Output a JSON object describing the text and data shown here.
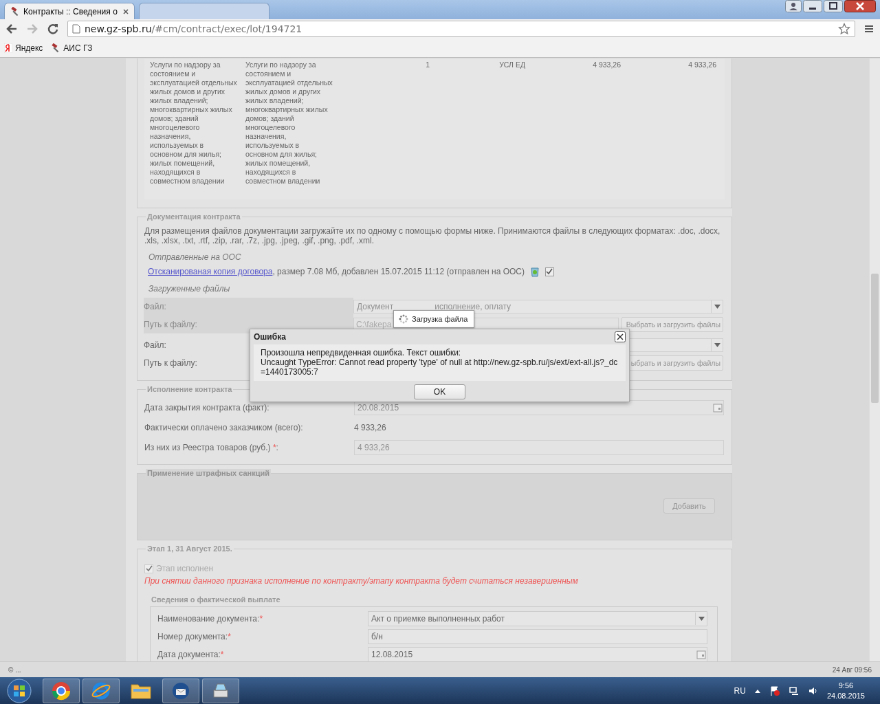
{
  "browser": {
    "tabs": [
      {
        "title": "Контракты :: Сведения о",
        "selected": true
      },
      {
        "selected": false
      }
    ],
    "url_host": "new.gz-spb.ru",
    "url_path": "/#cm/contract/exec/lot/194721",
    "bookmarks": [
      {
        "label": "Яндекс",
        "kind": "yandex"
      },
      {
        "label": "АИС ГЗ",
        "kind": "gavel"
      }
    ]
  },
  "items_row": [
    "Услуги по надзору за состоянием и эксплуатацией отдельных жилых домов и других жилых владений; многоквартирных жилых домов; зданий многоцелевого назначения, используемых в основном для жилья; жилых помещений, находящихся в совместном владении",
    "Услуги по надзору за состоянием и эксплуатацией отдельных жилых домов и других жилых владений; многоквартирных жилых домов; зданий многоцелевого назначения, используемых в основном для жилья; жилых помещений, находящихся в совместном владении",
    "1",
    "УСЛ ЕД",
    "4 933,26",
    "4 933,26"
  ],
  "documentation": {
    "legend": "Документация контракта",
    "info": "Для размещения файлов документации загружайте их по одному с помощью формы ниже. Принимаются файлы в следующих форматах: .doc, .docx, .xls, .xlsx, .txt, .rtf, .zip, .rar, .7z, .jpg, .jpeg, .gif, .png, .pdf, .xml.",
    "sent_heading": "Отправленные на ООС",
    "file_link": "Отсканированая копия договора",
    "file_details": ", размер 7.08 Мб, добавлен 15.07.2015 11:12 (отправлен на ООС)",
    "file_checked": true,
    "uploaded_heading": "Загруженные файлы",
    "upload_rows": [
      {
        "file_label": "Файл:",
        "file_value_parts": [
          "Документ",
          "исполнение, оплату"
        ],
        "path_label": "Путь к файлу:",
        "path_value": "C:\\fakepa",
        "button": "Выбрать и загрузить файлы",
        "highlighted": true
      },
      {
        "file_label": "Файл:",
        "path_label": "Путь к файлу:",
        "button": "ыбрать и загрузить файлы",
        "highlighted": false
      }
    ]
  },
  "loading_tooltip": "Загрузка файла",
  "error_dialog": {
    "title": "Ошибка",
    "line_1": "Произошла непредвиденная ошибка. Текст ошибки:",
    "line_2": "Uncaught TypeError: Cannot read property 'type' of null at http://new.gz-spb.ru/js/ext/ext-all.js?_dc=1440173005:7",
    "ok": "OK"
  },
  "execution": {
    "legend": "Исполнение контракта",
    "fields": [
      {
        "label": "Дата закрытия контракта (факт):",
        "value": "20.08.2015",
        "kind": "date"
      },
      {
        "label": "Фактически оплачено заказчиком (всего):",
        "value": "4 933,26",
        "kind": "text"
      },
      {
        "label": "Из них из Реестра товаров (руб.)",
        "required_mark": "*",
        "label_end": ":",
        "value": "4 933,26",
        "kind": "input"
      }
    ]
  },
  "penalties": {
    "legend": "Применение штрафных санкций",
    "add_button": "Добавить"
  },
  "stage": {
    "legend": "Этап 1, 31 Август 2015.",
    "checkbox_label": "Этап исполнен",
    "checked": true,
    "warning": "При снятии данного признака исполнение по контракту/этапу контракта будет считаться незавершенным",
    "payment": {
      "legend": "Сведения о фактической выплате",
      "fields": [
        {
          "label": "Наименование документа:",
          "required_mark": "*",
          "value": "Акт о приемке выполненных работ",
          "kind": "select"
        },
        {
          "label": "Номер документа:",
          "required_mark": "*",
          "value": "б/н",
          "kind": "input"
        },
        {
          "label": "Дата документа:",
          "required_mark": "*",
          "value": "12.08.2015",
          "kind": "date"
        }
      ]
    }
  },
  "status_bar": {
    "left": "© ...",
    "right": "24 Авг 09:56"
  },
  "taskbar": {
    "language": "RU",
    "time": "9:56",
    "date": "24.08.2015"
  }
}
